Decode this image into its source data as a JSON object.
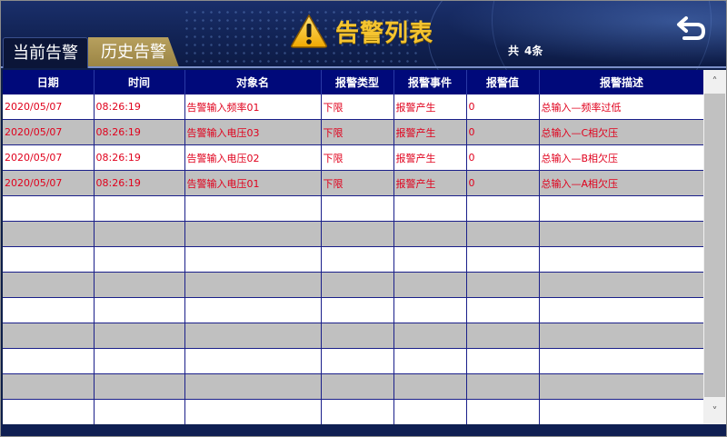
{
  "header": {
    "title": "告警列表",
    "count_prefix": "共",
    "count_value": "4条"
  },
  "tabs": [
    {
      "label": "当前告警",
      "active": true
    },
    {
      "label": "历史告警",
      "active": false
    }
  ],
  "table": {
    "columns": [
      "日期",
      "时间",
      "对象名",
      "报警类型",
      "报警事件",
      "报警值",
      "报警描述"
    ],
    "rows": [
      [
        "2020/05/07",
        "08:26:19",
        "告警输入频率01",
        "下限",
        "报警产生",
        "0",
        "总输入—频率过低"
      ],
      [
        "2020/05/07",
        "08:26:19",
        "告警输入电压03",
        "下限",
        "报警产生",
        "0",
        "总输入—C相欠压"
      ],
      [
        "2020/05/07",
        "08:26:19",
        "告警输入电压02",
        "下限",
        "报警产生",
        "0",
        "总输入—B相欠压"
      ],
      [
        "2020/05/07",
        "08:26:19",
        "告警输入电压01",
        "下限",
        "报警产生",
        "0",
        "总输入—A相欠压"
      ],
      [
        "",
        "",
        "",
        "",
        "",
        "",
        ""
      ],
      [
        "",
        "",
        "",
        "",
        "",
        "",
        ""
      ],
      [
        "",
        "",
        "",
        "",
        "",
        "",
        ""
      ],
      [
        "",
        "",
        "",
        "",
        "",
        "",
        ""
      ],
      [
        "",
        "",
        "",
        "",
        "",
        "",
        ""
      ],
      [
        "",
        "",
        "",
        "",
        "",
        "",
        ""
      ],
      [
        "",
        "",
        "",
        "",
        "",
        "",
        ""
      ],
      [
        "",
        "",
        "",
        "",
        "",
        "",
        ""
      ],
      [
        "",
        "",
        "",
        "",
        "",
        "",
        ""
      ]
    ]
  },
  "icons": {
    "warning": "warning-triangle-icon",
    "back": "back-arrow-icon",
    "scroll_up": "chevron-up-icon",
    "scroll_down": "chevron-down-icon"
  },
  "colors": {
    "header_bg": "#132558",
    "title": "#f5c430",
    "table_header_bg": "#00097a",
    "alarm_text": "#e0001c",
    "row_alt": "#c0c0c0"
  }
}
